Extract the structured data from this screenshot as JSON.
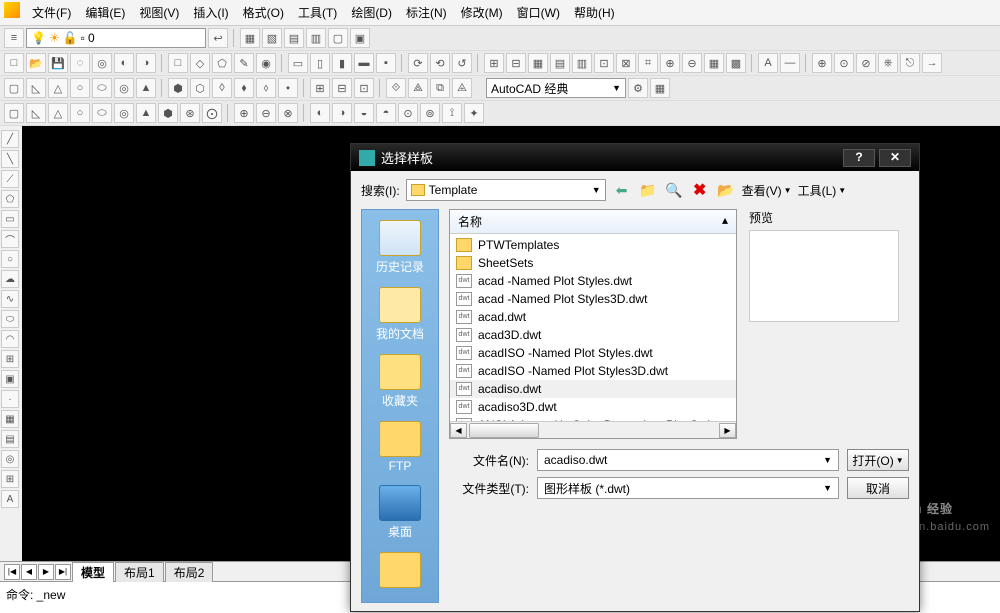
{
  "menu": [
    "文件(F)",
    "编辑(E)",
    "视图(V)",
    "插入(I)",
    "格式(O)",
    "工具(T)",
    "绘图(D)",
    "标注(N)",
    "修改(M)",
    "窗口(W)",
    "帮助(H)"
  ],
  "layer": {
    "current": "0"
  },
  "workspace": {
    "label": "AutoCAD 经典"
  },
  "tabs": {
    "items": [
      "模型",
      "布局1",
      "布局2"
    ],
    "active": 0,
    "nav": [
      "|◀",
      "◀",
      "▶",
      "▶|"
    ]
  },
  "cmdline": {
    "text": "命令: _new"
  },
  "watermark": {
    "main": "Baidu 经验",
    "sub": "jingyan.baidu.com"
  },
  "dialog": {
    "title": "选择样板",
    "help": "?",
    "close": "✕",
    "search_label": "搜索(I):",
    "path": "Template",
    "view_label": "查看(V)",
    "tools_label": "工具(L)",
    "preview_label": "预览",
    "list_header": "名称",
    "places": [
      {
        "label": "历史记录",
        "cls": "history"
      },
      {
        "label": "我的文档",
        "cls": "docs"
      },
      {
        "label": "收藏夹",
        "cls": "fav"
      },
      {
        "label": "FTP",
        "cls": "ftp"
      },
      {
        "label": "桌面",
        "cls": "desktop"
      },
      {
        "label": "",
        "cls": "more"
      }
    ],
    "files": [
      {
        "name": "PTWTemplates",
        "type": "folder"
      },
      {
        "name": "SheetSets",
        "type": "folder"
      },
      {
        "name": "acad -Named Plot Styles.dwt",
        "type": "dwt"
      },
      {
        "name": "acad -Named Plot Styles3D.dwt",
        "type": "dwt"
      },
      {
        "name": "acad.dwt",
        "type": "dwt"
      },
      {
        "name": "acad3D.dwt",
        "type": "dwt"
      },
      {
        "name": "acadISO -Named Plot Styles.dwt",
        "type": "dwt"
      },
      {
        "name": "acadISO -Named Plot Styles3D.dwt",
        "type": "dwt"
      },
      {
        "name": "acadiso.dwt",
        "type": "dwt",
        "selected": true
      },
      {
        "name": "acadiso3D.dwt",
        "type": "dwt"
      },
      {
        "name": "ANSI A (portrait) -Color Dependent Plot Styl...",
        "type": "dwt"
      }
    ],
    "filename_label": "文件名(N):",
    "filename_value": "acadiso.dwt",
    "filetype_label": "文件类型(T):",
    "filetype_value": "图形样板 (*.dwt)",
    "open_btn": "打开(O)",
    "cancel_btn": "取消"
  }
}
